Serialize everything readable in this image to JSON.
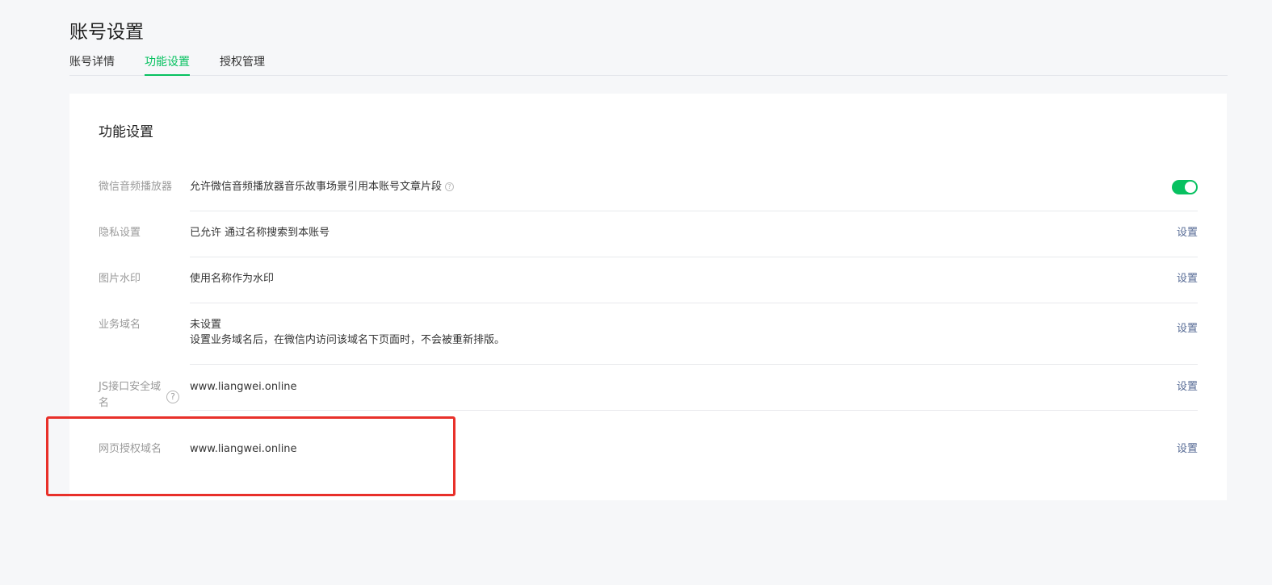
{
  "page": {
    "title": "账号设置"
  },
  "tabs": [
    {
      "label": "账号详情"
    },
    {
      "label": "功能设置"
    },
    {
      "label": "授权管理"
    }
  ],
  "card": {
    "title": "功能设置"
  },
  "rows": [
    {
      "label": "微信音频播放器",
      "value": "允许微信音频播放器音乐故事场景引用本账号文章片段",
      "help_icon": "question-circle-icon",
      "control": "toggle",
      "toggle_on": true
    },
    {
      "label": "隐私设置",
      "value": "已允许 通过名称搜索到本账号",
      "action": "设置"
    },
    {
      "label": "图片水印",
      "value": "使用名称作为水印",
      "action": "设置"
    },
    {
      "label": "业务域名",
      "value": "未设置",
      "subvalue": "设置业务域名后，在微信内访问该域名下页面时，不会被重新排版。",
      "action": "设置"
    },
    {
      "label": "JS接口安全域名",
      "value": "www.liangwei.online",
      "help_icon": "question-circle-icon",
      "action": "设置"
    },
    {
      "label": "网页授权域名",
      "value": "www.liangwei.online",
      "action": "设置"
    }
  ],
  "icons": {
    "help": "?"
  },
  "colors": {
    "accent": "#07c160",
    "link": "#576b95",
    "highlight": "#e8302a"
  }
}
